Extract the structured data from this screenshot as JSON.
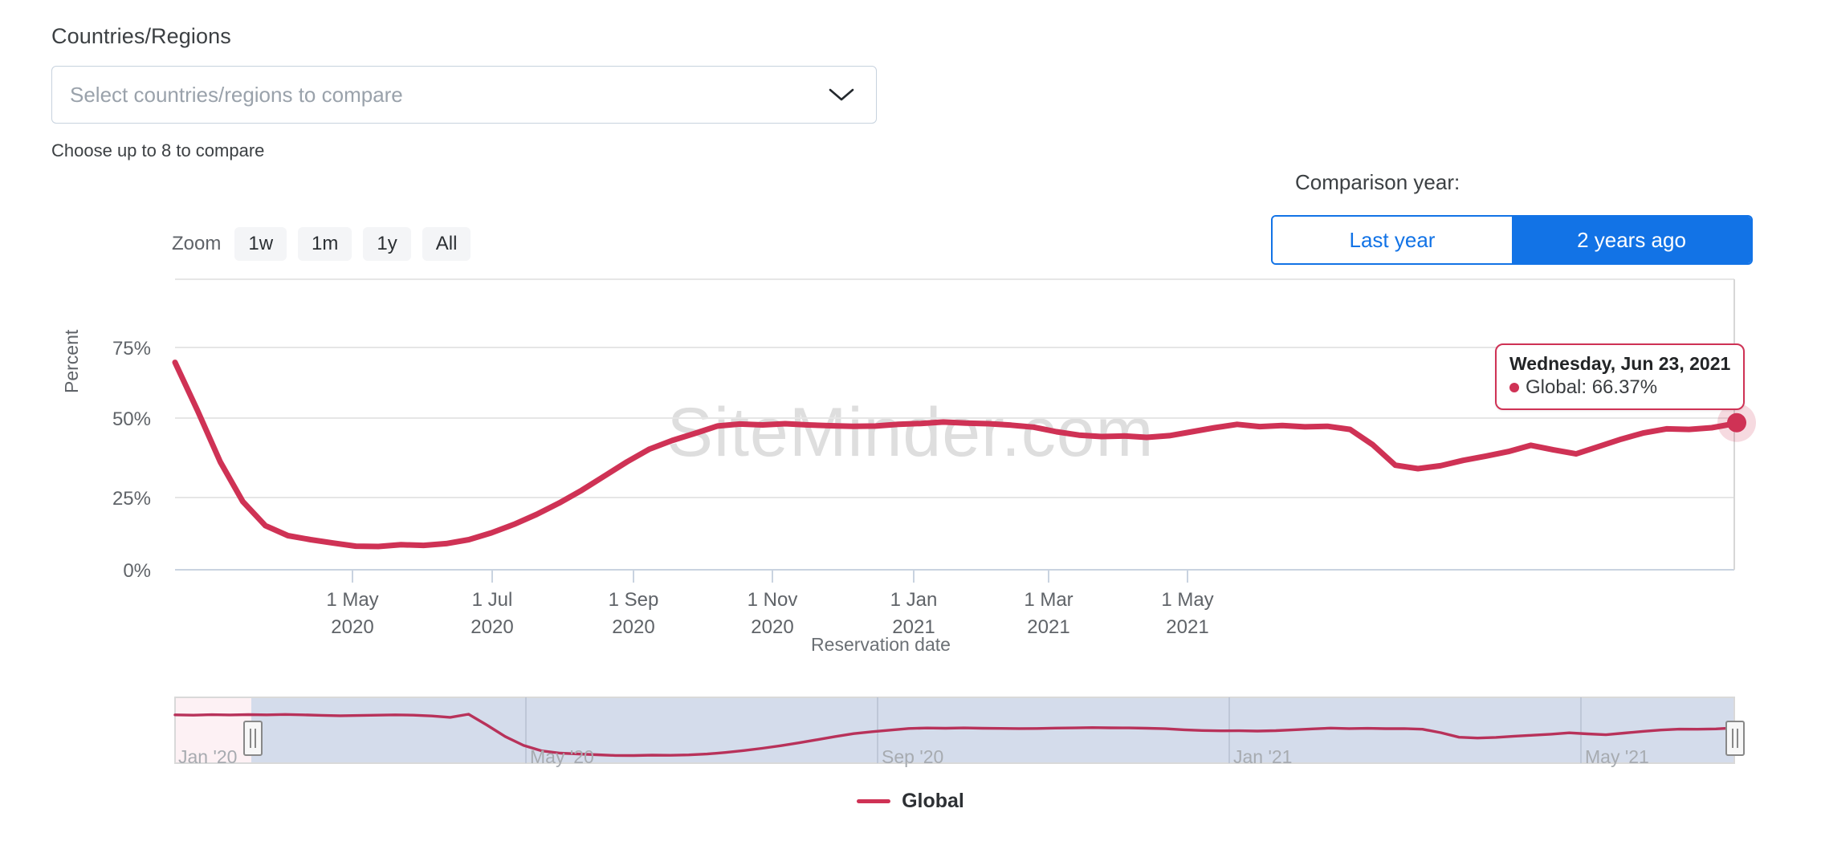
{
  "countries_filter": {
    "label": "Countries/Regions",
    "placeholder": "Select countries/regions to compare",
    "help_text": "Choose up to 8 to compare",
    "chevron_icon": "chevron-down-icon"
  },
  "comparison": {
    "label": "Comparison year:",
    "options": [
      {
        "label": "Last year",
        "selected": false
      },
      {
        "label": "2 years ago",
        "selected": true
      }
    ]
  },
  "zoom": {
    "label": "Zoom",
    "buttons": [
      "1w",
      "1m",
      "1y",
      "All"
    ]
  },
  "tooltip": {
    "date": "Wednesday, Jun 23, 2021",
    "series_name": "Global",
    "value_text": "Global: 66.37%",
    "value": 66.37,
    "marker_color": "#cf3255"
  },
  "watermark": "SiteMinder.com",
  "legend": [
    {
      "label": "Global",
      "color": "#cf3255"
    }
  ],
  "navigator": {
    "labels": [
      "Jan '20",
      "May '20",
      "Sep '20",
      "Jan '21",
      "May '21"
    ],
    "selected_mask_color": "#ccd6e8",
    "handle_left_label": "navigator-handle-left",
    "handle_right_label": "navigator-handle-right"
  },
  "colors": {
    "series": "#cf3255",
    "accent_blue": "#1273e6",
    "gridline": "#e6e6e6",
    "axis": "#c9d3e0"
  },
  "chart_data": {
    "type": "line",
    "title": "",
    "xlabel": "Reservation date",
    "ylabel": "Percent",
    "ylim": [
      0,
      100
    ],
    "ytick_labels": [
      "0%",
      "25%",
      "50%",
      "75%"
    ],
    "ytick_values": [
      0,
      25,
      50,
      75
    ],
    "grid": true,
    "legend_position": "bottom",
    "xtick_labels": [
      "1 May\n2020",
      "1 Jul\n2020",
      "1 Sep\n2020",
      "1 Nov\n2020",
      "1 Jan\n2021",
      "1 Mar\n2021",
      "1 May\n2021"
    ],
    "xticks": [
      {
        "line1": "1 May",
        "line2": "2020"
      },
      {
        "line1": "1 Jul",
        "line2": "2020"
      },
      {
        "line1": "1 Sep",
        "line2": "2020"
      },
      {
        "line1": "1 Nov",
        "line2": "2020"
      },
      {
        "line1": "1 Jan",
        "line2": "2021"
      },
      {
        "line1": "1 Mar",
        "line2": "2021"
      },
      {
        "line1": "1 May",
        "line2": "2021"
      }
    ],
    "x_range": [
      "2020-03-20",
      "2021-06-23"
    ],
    "series": [
      {
        "name": "Global",
        "color": "#cf3255",
        "x": [
          "2020-03-20",
          "2020-03-24",
          "2020-03-28",
          "2020-04-01",
          "2020-04-05",
          "2020-04-09",
          "2020-04-13",
          "2020-04-18",
          "2020-04-24",
          "2020-05-01",
          "2020-05-08",
          "2020-05-15",
          "2020-05-22",
          "2020-05-29",
          "2020-06-05",
          "2020-06-12",
          "2020-06-19",
          "2020-06-26",
          "2020-07-03",
          "2020-07-10",
          "2020-07-17",
          "2020-07-24",
          "2020-07-31",
          "2020-08-07",
          "2020-08-14",
          "2020-08-21",
          "2020-08-28",
          "2020-09-04",
          "2020-09-11",
          "2020-09-18",
          "2020-09-25",
          "2020-10-02",
          "2020-10-09",
          "2020-10-16",
          "2020-10-23",
          "2020-10-30",
          "2020-11-06",
          "2020-11-13",
          "2020-11-20",
          "2020-11-27",
          "2020-12-04",
          "2020-12-11",
          "2020-12-18",
          "2020-12-25",
          "2021-01-01",
          "2021-01-08",
          "2021-01-15",
          "2021-01-22",
          "2021-01-29",
          "2021-02-05",
          "2021-02-12",
          "2021-02-19",
          "2021-02-26",
          "2021-03-05",
          "2021-03-12",
          "2021-03-19",
          "2021-03-26",
          "2021-04-02",
          "2021-04-09",
          "2021-04-16",
          "2021-04-23",
          "2021-04-30",
          "2021-05-07",
          "2021-05-14",
          "2021-05-21",
          "2021-05-28",
          "2021-06-04",
          "2021-06-11",
          "2021-06-18",
          "2021-06-23"
        ],
        "y": [
          73.0,
          56.0,
          38.0,
          24.0,
          15.5,
          12.0,
          10.6,
          9.4,
          8.3,
          8.2,
          8.8,
          8.6,
          9.2,
          10.6,
          13.0,
          16.0,
          19.5,
          23.5,
          28.0,
          33.0,
          38.0,
          42.5,
          45.5,
          48.0,
          50.6,
          51.3,
          51.0,
          51.4,
          51.0,
          50.7,
          50.5,
          50.6,
          51.2,
          51.5,
          52.0,
          51.6,
          51.4,
          50.9,
          50.2,
          48.6,
          47.4,
          46.9,
          47.1,
          46.6,
          47.2,
          48.6,
          50.0,
          51.2,
          50.4,
          50.8,
          50.3,
          50.5,
          49.4,
          44.0,
          36.8,
          35.6,
          36.6,
          38.5,
          40.0,
          41.6,
          43.8,
          42.2,
          40.8,
          43.4,
          46.0,
          48.2,
          49.6,
          49.4,
          50.0,
          51.4
        ]
      }
    ],
    "annotation": {
      "point_date": "2021-06-23",
      "point_value": 66.37,
      "label": "Wednesday, Jun 23, 2021 — Global: 66.37%"
    }
  }
}
